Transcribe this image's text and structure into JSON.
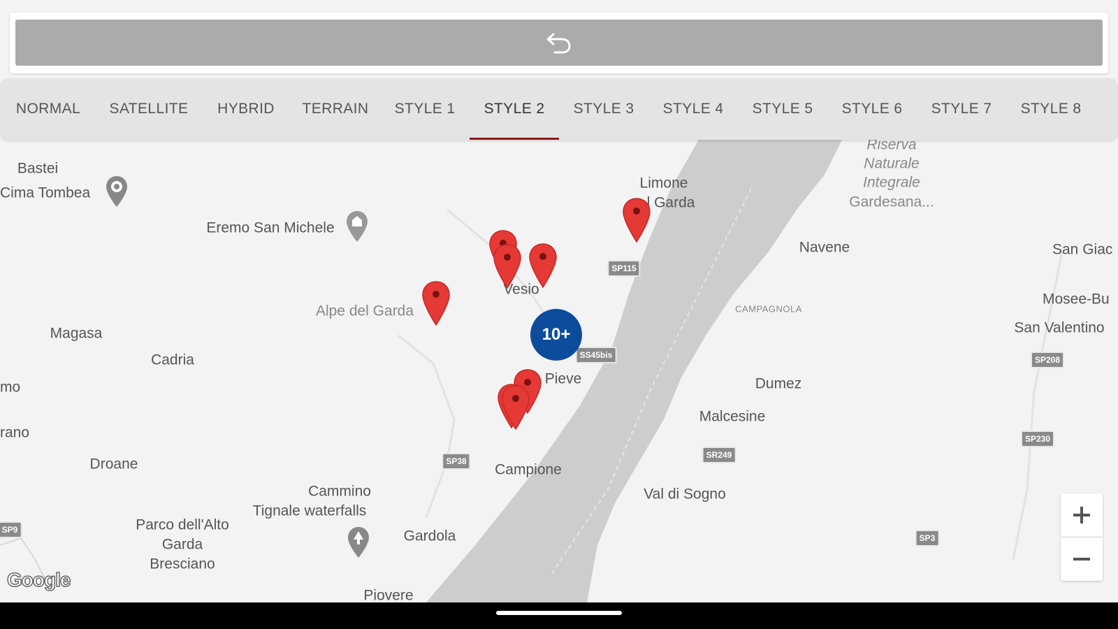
{
  "toolbar": {
    "undo_icon": "undo-icon"
  },
  "tabs": [
    {
      "label": "NORMAL",
      "active": false
    },
    {
      "label": "SATELLITE",
      "active": false
    },
    {
      "label": "HYBRID",
      "active": false
    },
    {
      "label": "TERRAIN",
      "active": false
    },
    {
      "label": "STYLE 1",
      "active": false
    },
    {
      "label": "STYLE 2",
      "active": true
    },
    {
      "label": "STYLE 3",
      "active": false
    },
    {
      "label": "STYLE 4",
      "active": false
    },
    {
      "label": "STYLE 5",
      "active": false
    },
    {
      "label": "STYLE 6",
      "active": false
    },
    {
      "label": "STYLE 7",
      "active": false
    },
    {
      "label": "STYLE 8",
      "active": false
    }
  ],
  "map": {
    "places": {
      "bastei": "Bastei",
      "cima_tombea": "Cima Tombea",
      "eremo": "Eremo San Michele",
      "limone_1": "Limone",
      "limone_2": "l Garda",
      "riserva_1": "Riserva",
      "riserva_2": "Naturale",
      "riserva_3": "Integrale",
      "riserva_4": "Gardesana...",
      "navene": "Navene",
      "san_giac": "San Giac",
      "vesio": "Vesio",
      "alpe": "Alpe del Garda",
      "magasa": "Magasa",
      "cadria": "Cadria",
      "campagnola": "CAMPAGNOLA",
      "mosee": "Mosee-Bu",
      "san_valentino": "San Valentino",
      "pieve": "Pieve",
      "dumez": "Dumez",
      "malcesine": "Malcesine",
      "mo": "mo",
      "rano": "rano",
      "droane": "Droane",
      "campione": "Campione",
      "val_di_sogno": "Val di Sogno",
      "cammino_1": "Cammino",
      "cammino_2": "Tignale waterfalls",
      "parco_1": "Parco dell'Alto",
      "parco_2": "Garda",
      "parco_3": "Bresciano",
      "gardola": "Gardola",
      "piovere": "Piovere"
    },
    "roads": {
      "sp115": "SP115",
      "ss45bis": "SS45bis",
      "sp208": "SP208",
      "sp230": "SP230",
      "sp38": "SP38",
      "sr249": "SR249",
      "sp9": "SP9",
      "sp3": "SP3"
    },
    "cluster_label": "10+",
    "google_logo": "Google",
    "marker_color": "#e53935",
    "cluster_color": "#0d4c9c",
    "lake_color": "#cdcdcd"
  },
  "zoom": {
    "in_label": "+",
    "out_label": "−"
  }
}
